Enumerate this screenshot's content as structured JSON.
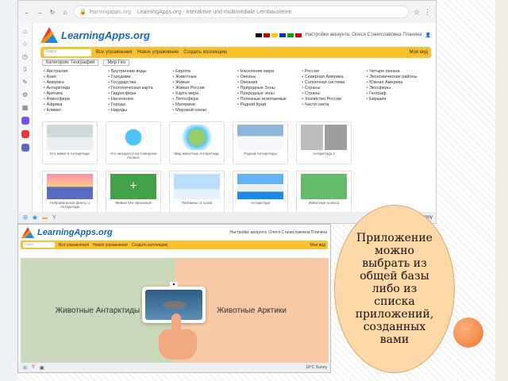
{
  "browser": {
    "url": "learningapps.org",
    "tab_title": "LearningApps.org - interaktive und multimediale Lernbausteine"
  },
  "site": {
    "logo_text": "LearningApps.org",
    "user_line": "Настройки аккаунта: Олеся Станиславовна Плачина",
    "search_placeholder": "Поиск",
    "toolbar": [
      "Все упражнения",
      "Новое упражнение",
      "Создать коллекцию",
      "Мои вид"
    ],
    "filter_label": "Категория: География",
    "filter_select": "Мир Гео",
    "topics": [
      [
        "Австралия",
        "Азия",
        "Америка",
        "Антарктида",
        "Арктика",
        "Атмосфера",
        "Африка",
        "Климат"
      ],
      [
        "Внутренние воды",
        "Городами",
        "Государства",
        "Геологическая карта",
        "Гидросфера",
        "Населения",
        "Города",
        "Народы"
      ],
      [
        "Европа",
        "Животные",
        "Живые",
        "Живая Россия",
        "Карта мира",
        "Литосфера",
        "Материки",
        "Мировой океан"
      ],
      [
        "Население мира",
        "Океаны",
        "Океания",
        "Природные Зоны",
        "Природные зоны",
        "Полезные ископаемые",
        "Родной Край"
      ],
      [
        "Россия",
        "Северная Америка",
        "Солнечная система",
        "Страны",
        "Страны",
        "Хозяйство России",
        "Части света"
      ],
      [
        "Четыре океана",
        "Экономические районы",
        "Южная Америка",
        "Экосферы",
        "Географ",
        "Евразия"
      ]
    ],
    "apps": [
      {
        "caption": "Кто живет в Антарктиде",
        "icon": "seal-image"
      },
      {
        "caption": "Что находится на Северном полюсе",
        "icon": "diagram-image"
      },
      {
        "caption": "Мир животных Антарктиды",
        "icon": "globe-image"
      },
      {
        "caption": "Родной Антарктиды",
        "icon": "iceberg-image"
      },
      {
        "caption": "Антарктида 2",
        "icon": "portraits-image"
      },
      {
        "caption": "",
        "icon": "empty"
      },
      {
        "caption": "Неправильные факты о Антарктиде",
        "icon": "sunset-image"
      },
      {
        "caption": "Живые без признаков",
        "icon": "plus-image"
      },
      {
        "caption": "Пингвины острова",
        "icon": "penguin-image"
      },
      {
        "caption": "Антарктида",
        "icon": "mountains-image"
      },
      {
        "caption": "Животные полюса",
        "icon": "green-card-image"
      },
      {
        "caption": "",
        "icon": "empty"
      }
    ]
  },
  "game": {
    "left_label": "Животные Антарктиды",
    "right_label": "Животные Арктики",
    "card_image": "seal-on-ice"
  },
  "taskbar": {
    "weather": "18°C Sunny"
  },
  "callout": {
    "text": "Приложение можно выбрать из общей базы либо из списка приложений, созданных вами"
  },
  "colors": {
    "toolbar_yellow": "#fbc02d",
    "logo_blue": "#1565c0",
    "callout_fill": "#ffd8a8",
    "game_left": "#c9d8b8",
    "game_right": "#f7c9a6"
  }
}
